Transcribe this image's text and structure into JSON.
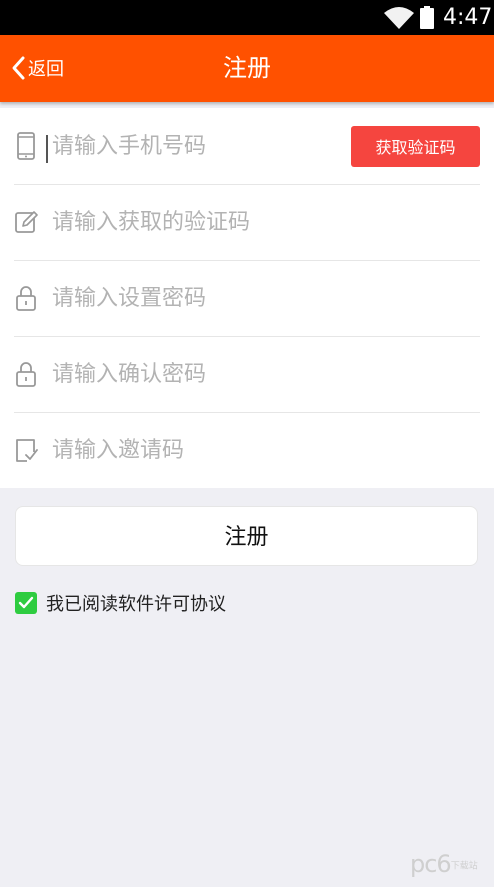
{
  "status_bar": {
    "time": "4:47",
    "wifi_icon": "wifi-icon",
    "battery_icon": "battery-icon"
  },
  "nav": {
    "back_label": "返回",
    "title": "注册"
  },
  "form": {
    "phone_placeholder": "请输入手机号码",
    "sms_button": "获取验证码",
    "code_placeholder": "请输入获取的验证码",
    "password_placeholder": "请输入设置密码",
    "confirm_placeholder": "请输入确认密码",
    "invite_placeholder": "请输入邀请码"
  },
  "register_button": "注册",
  "agreement": {
    "checked": true,
    "label": "我已阅读软件许可协议"
  },
  "watermark": {
    "text": "pc6",
    "small": "下载站"
  },
  "colors": {
    "accent": "#ff5100",
    "sms_button": "#f5453f",
    "checkbox": "#2ecc40",
    "background": "#efeff4"
  }
}
